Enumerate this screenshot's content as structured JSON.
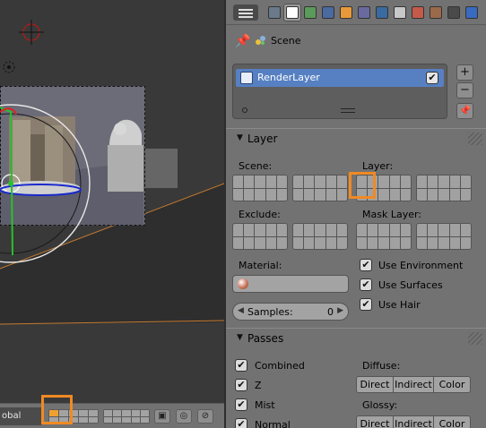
{
  "viewport": {
    "orientation_label": "obal"
  },
  "properties": {
    "tabs": [
      {
        "icon": "render-icon",
        "color": "#6a7a8a"
      },
      {
        "icon": "render-layers-icon",
        "color": "#ffffff"
      },
      {
        "icon": "scene-icon",
        "color": "#5a9a5a"
      },
      {
        "icon": "world-icon",
        "color": "#4a6aa0"
      },
      {
        "icon": "object-icon",
        "color": "#e89a3a"
      },
      {
        "icon": "constraints-icon",
        "color": "#6a6aa0"
      },
      {
        "icon": "modifiers-icon",
        "color": "#3a6aa0"
      },
      {
        "icon": "data-icon",
        "color": "#c8c8c8"
      },
      {
        "icon": "material-icon",
        "color": "#c55a4a"
      },
      {
        "icon": "texture-icon",
        "color": "#9a6a4a"
      },
      {
        "icon": "particles-icon",
        "color": "#4a4a4a"
      },
      {
        "icon": "physics-icon",
        "color": "#3a6ac0"
      }
    ],
    "context": {
      "scene": "Scene"
    },
    "render_layers": {
      "items": [
        {
          "label": "RenderLayer",
          "checked": "✔"
        }
      ]
    },
    "layer_panel": {
      "title": "Layer",
      "scene_label": "Scene:",
      "layer_label": "Layer:",
      "exclude_label": "Exclude:",
      "mask_layer_label": "Mask Layer:",
      "material_label": "Material:",
      "samples_label": "Samples:",
      "samples_value": "0",
      "use_environment": "Use Environment",
      "use_surfaces": "Use Surfaces",
      "use_hair": "Use Hair"
    },
    "passes_panel": {
      "title": "Passes",
      "combined": "Combined",
      "z": "Z",
      "mist": "Mist",
      "normal": "Normal",
      "diffuse_label": "Diffuse:",
      "glossy_label": "Glossy:",
      "direct": "Direct",
      "indirect": "Indirect",
      "color": "Color"
    }
  },
  "colors": {
    "highlight": "#f08a24",
    "selection": "#5680c2",
    "active_layer": "#f0a030"
  }
}
